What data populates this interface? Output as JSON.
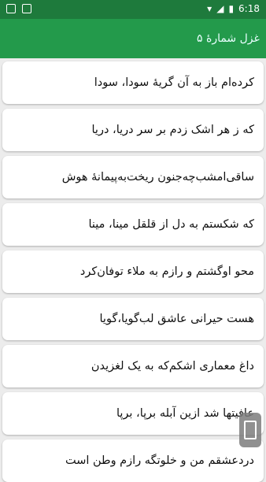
{
  "status_bar": {
    "time": "6:18"
  },
  "app_bar": {
    "title": "غزل شمارهٔ ۵"
  },
  "verses": [
    "کرده‌ام باز به آن گریهٔ سودا، سودا",
    "که ز هر اشک زدم بر سر دریا، دریا",
    "ساقی‌امشب‌چه‌جنون ریخت‌به‌پیمانهٔ هوش",
    "که شکستم به دل از قلقل مینا، مینا",
    "محو اوگشتم و رازم به ملاء توفان‌کرد",
    "هست حیرانی عاشق لب‌گویا،گویا",
    "داغ معماری اشکم‌که به یک لغزیدن",
    "عافیتها شد ازین آبله برپا، برپا",
    "دردعشقم من و خلوتگه رازم وطن است"
  ]
}
